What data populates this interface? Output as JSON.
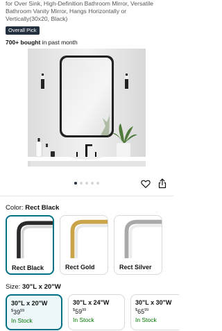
{
  "product": {
    "title": "for Over Sink, High-Definition Bathroom Mirror, Versatile Bathroom Vanity Mirror, Hangs Horizontally or Vertically(30x20, Black)",
    "badge": "Overall Pick",
    "bought_count": "700+ bought",
    "bought_suffix": " in past month"
  },
  "gallery": {
    "dot_count": 5,
    "active_index": 0
  },
  "color": {
    "label": "Color:",
    "selected": "Rect Black",
    "options": [
      {
        "name": "Rect Black",
        "frame_color": "#2b2b2b",
        "selected": true
      },
      {
        "name": "Rect Gold",
        "frame_color": "#c9a44a",
        "selected": false
      },
      {
        "name": "Rect Silver",
        "frame_color": "#a9a9a9",
        "selected": false
      }
    ]
  },
  "size": {
    "label": "Size:",
    "selected": "30\"L x 20\"W",
    "options": [
      {
        "size": "30\"L x 20\"W",
        "currency": "$",
        "whole": "39",
        "cents": "59",
        "stock": "In Stock",
        "selected": true
      },
      {
        "size": "30\"L x 24\"W",
        "currency": "$",
        "whole": "59",
        "cents": "99",
        "stock": "In Stock",
        "selected": false
      },
      {
        "size": "30\"L x 30\"W",
        "currency": "$",
        "whole": "65",
        "cents": "99",
        "stock": "In Stock",
        "selected": false
      }
    ]
  },
  "icons": {
    "wishlist": "heart-icon",
    "share": "share-icon"
  },
  "colors": {
    "accent": "#007185",
    "badge_bg": "#232f3e",
    "in_stock": "#007600"
  }
}
